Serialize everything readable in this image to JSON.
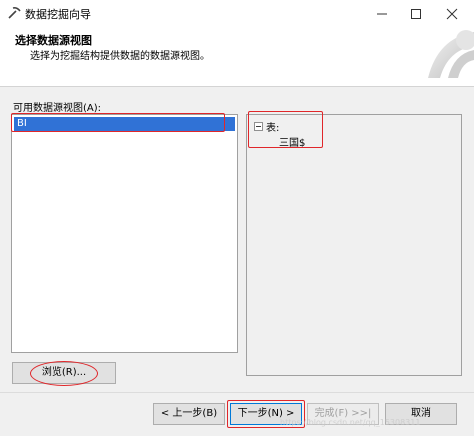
{
  "window": {
    "title": "数据挖掘向导"
  },
  "header": {
    "title": "选择数据源视图",
    "subtitle": "选择为挖掘结构提供数据的数据源视图。"
  },
  "data_source_view_list": {
    "label": "可用数据源视图(A):",
    "items": [
      {
        "label": "BI",
        "selected": true
      }
    ]
  },
  "detail_panel": {
    "group_label": "表:",
    "tables": [
      "三国$"
    ]
  },
  "buttons": {
    "browse": "浏览(R)...",
    "back": "< 上一步(B)",
    "next": "下一步(N) >",
    "finish": "完成(F) >>|",
    "cancel": "取消"
  },
  "watermark": "https://blog.csdn.net/qq_15308311",
  "colors": {
    "selection": "#3072d6",
    "annotation": "#e0262a",
    "dialog_background": "#f0f0f0"
  },
  "icons": {
    "app": "pick-icon",
    "minimize": "minimize-icon",
    "maximize": "maximize-icon",
    "close": "close-icon",
    "tree_toggle": "collapse-icon"
  }
}
